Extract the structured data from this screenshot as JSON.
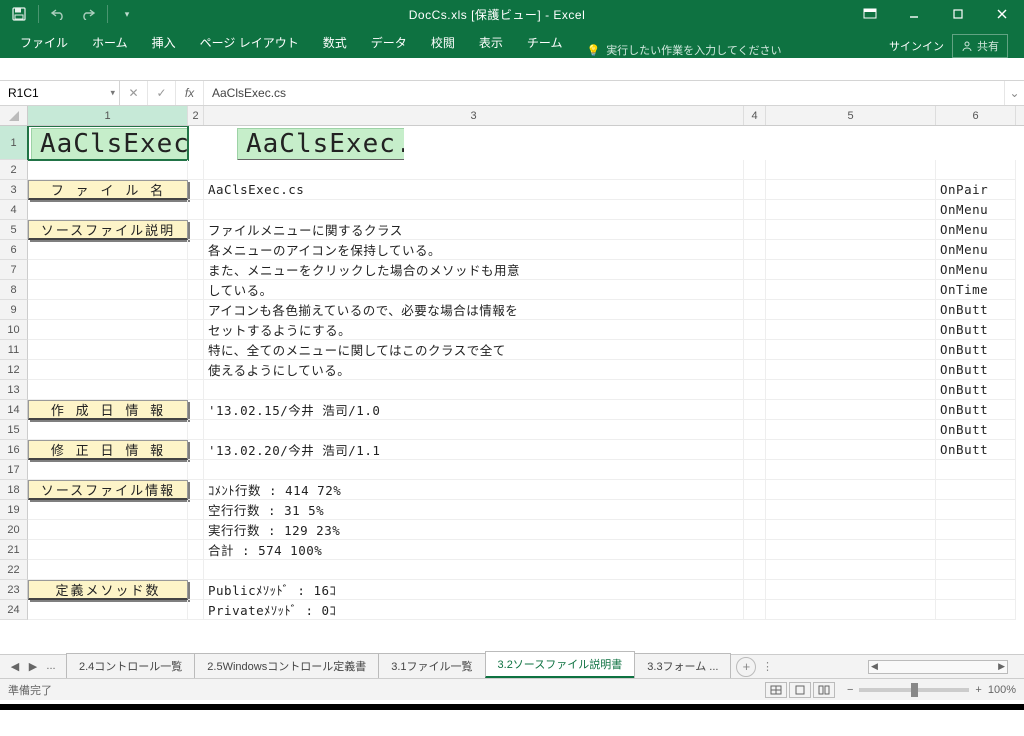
{
  "window": {
    "title": "DocCs.xls  [保護ビュー] - Excel"
  },
  "qat": {
    "save": "save",
    "undo": "undo",
    "redo": "redo",
    "more": "▾"
  },
  "ribbon": {
    "tabs": [
      "ファイル",
      "ホーム",
      "挿入",
      "ページ レイアウト",
      "数式",
      "データ",
      "校閲",
      "表示",
      "チーム"
    ],
    "tellme": "実行したい作業を入力してください",
    "signin": "サインイン",
    "share": "共有"
  },
  "fbar": {
    "nameBox": "R1C1",
    "formula": "AaClsExec.cs"
  },
  "cols": [
    "1",
    "2",
    "3",
    "4",
    "5",
    "6"
  ],
  "sheet": {
    "bigTitle": "AaClsExec.cs",
    "bigTitle5": "AaClsExec.cs",
    "labels": {
      "fileName": "フ ァ イ ル 名",
      "sourceDesc": "ソースファイル説明",
      "created": "作 成 日 情 報",
      "modified": "修 正 日 情 報",
      "sourceInfo": "ソースファイル情報",
      "methodCount": "定義メソッド数"
    },
    "vals": {
      "r3c3": "AaClsExec.cs",
      "r5c3": "ファイルメニューに関するクラス",
      "r6c3": "各メニューのアイコンを保持している。",
      "r7c3": "また、メニューをクリックした場合のメソッドも用意",
      "r8c3": "している。",
      "r9c3": "アイコンも各色揃えているので、必要な場合は情報を",
      "r10c3": "セットするようにする。",
      "r11c3": "特に、全てのメニューに関してはこのクラスで全て",
      "r12c3": "使えるようにしている。",
      "r14c3": "'13.02.15/今井 浩司/1.0",
      "r16c3": "'13.02.20/今井 浩司/1.1",
      "r18c3": "ｺﾒﾝﾄ行数 :    414    72%",
      "r19c3": "空行行数 :     31     5%",
      "r20c3": "実行行数 :    129    23%",
      "r21c3": "合計    :    574   100%",
      "r23c3": "Publicﾒｿｯﾄﾞ        :  16ｺ",
      "r24c3": "Privateﾒｿｯﾄﾞ       :   0ｺ"
    },
    "col6": {
      "r3": "OnPair",
      "r4": "OnMenu",
      "r5": "OnMenu",
      "r6": "OnMenu",
      "r7": "OnMenu",
      "r8": "OnTime",
      "r9": "OnButt",
      "r10": "OnButt",
      "r11": "OnButt",
      "r12": "OnButt",
      "r13": "OnButt",
      "r14": "OnButt",
      "r15": "OnButt",
      "r16": "OnButt"
    }
  },
  "tabs": {
    "list": [
      "2.4コントロール一覧",
      "2.5Windowsコントロール定義書",
      "3.1ファイル一覧",
      "3.2ソースファイル説明書",
      "3.3フォーム ..."
    ],
    "active": 3,
    "ellipsis": "..."
  },
  "status": {
    "ready": "準備完了",
    "zoom": "100%"
  }
}
